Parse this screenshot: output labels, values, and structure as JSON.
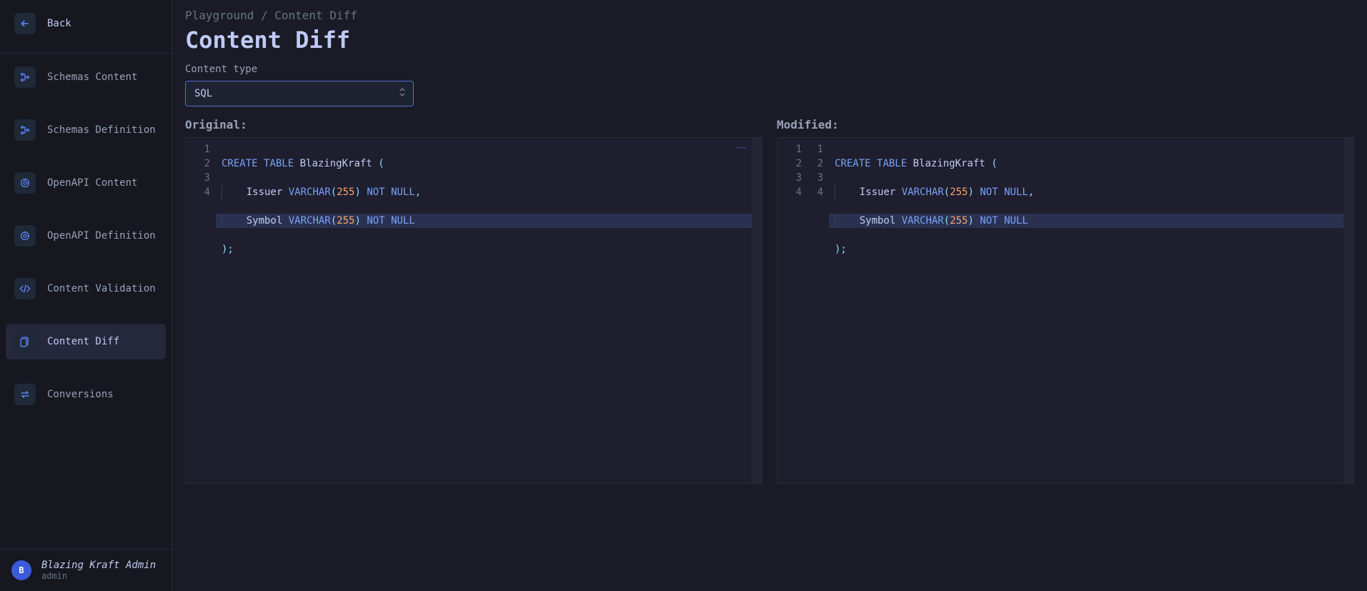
{
  "sidebar": {
    "back_label": "Back",
    "items": [
      {
        "label": "Schemas Content",
        "icon": "schema-icon"
      },
      {
        "label": "Schemas Definition",
        "icon": "schema-icon"
      },
      {
        "label": "OpenAPI Content",
        "icon": "openapi-icon"
      },
      {
        "label": "OpenAPI Definition",
        "icon": "openapi-icon"
      },
      {
        "label": "Content Validation",
        "icon": "code-icon"
      },
      {
        "label": "Content Diff",
        "icon": "diff-icon"
      },
      {
        "label": "Conversions",
        "icon": "conversion-icon"
      }
    ]
  },
  "user": {
    "avatar_letter": "B",
    "name": "Blazing Kraft Admin",
    "sub": "admin"
  },
  "breadcrumb": "Playground / Content Diff",
  "page_title": "Content Diff",
  "content_type_label": "Content type",
  "content_type_value": "SQL",
  "original_label": "Original:",
  "modified_label": "Modified:",
  "editors": {
    "original": {
      "gutter": [
        "1",
        "2",
        "3",
        "4"
      ],
      "code": {
        "l1_kw1": "CREATE",
        "l1_kw2": "TABLE",
        "l1_id": "BlazingKraft",
        "l1_par": "(",
        "l2_indentpad": "    ",
        "l2_col": "Issuer",
        "l2_type": "VARCHAR",
        "l2_num": "255",
        "l2_notnull": "NOT NULL",
        "l2_comma": ",",
        "l3_indentpad": "    ",
        "l3_col": "Symbol",
        "l3_type": "VARCHAR",
        "l3_num": "255",
        "l3_notnull": "NOT NULL",
        "l4_close": ");"
      }
    },
    "modified": {
      "gutter1": [
        "1",
        "2",
        "3",
        "4"
      ],
      "gutter2": [
        "1",
        "2",
        "3",
        "4"
      ],
      "code": {
        "l1_kw1": "CREATE",
        "l1_kw2": "TABLE",
        "l1_id": "BlazingKraft",
        "l1_par": "(",
        "l2_indentpad": "    ",
        "l2_col": "Issuer",
        "l2_type": "VARCHAR",
        "l2_num": "255",
        "l2_notnull": "NOT NULL",
        "l2_comma": ",",
        "l3_indentpad": "    ",
        "l3_col": "Symbol",
        "l3_type": "VARCHAR",
        "l3_num": "255",
        "l3_notnull": "NOT NULL",
        "l4_close": ");"
      }
    }
  }
}
